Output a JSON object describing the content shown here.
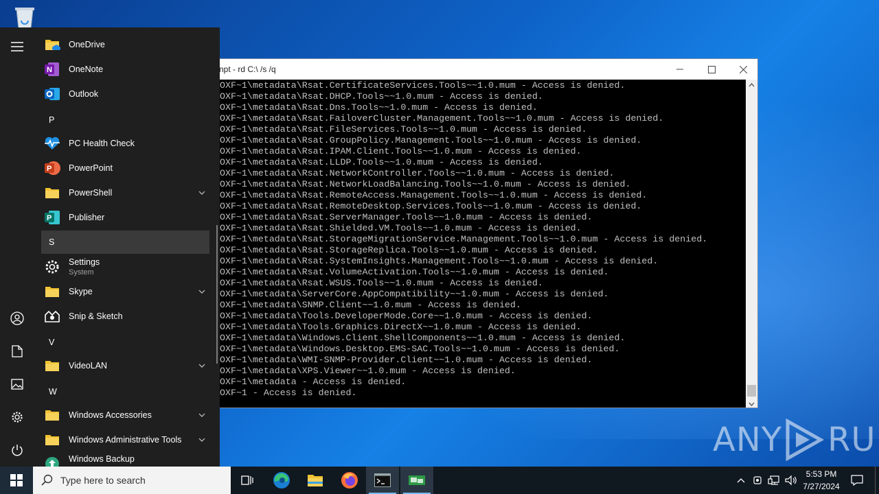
{
  "console": {
    "title": "npt - rd  C:\\ /s /q",
    "lines": [
      "OXF~1\\metadata\\Rsat.CertificateServices.Tools~~1.0.mum - Access is denied.",
      "OXF~1\\metadata\\Rsat.DHCP.Tools~~1.0.mum - Access is denied.",
      "OXF~1\\metadata\\Rsat.Dns.Tools~~1.0.mum - Access is denied.",
      "OXF~1\\metadata\\Rsat.FailoverCluster.Management.Tools~~1.0.mum - Access is denied.",
      "OXF~1\\metadata\\Rsat.FileServices.Tools~~1.0.mum - Access is denied.",
      "OXF~1\\metadata\\Rsat.GroupPolicy.Management.Tools~~1.0.mum - Access is denied.",
      "OXF~1\\metadata\\Rsat.IPAM.Client.Tools~~1.0.mum - Access is denied.",
      "OXF~1\\metadata\\Rsat.LLDP.Tools~~1.0.mum - Access is denied.",
      "OXF~1\\metadata\\Rsat.NetworkController.Tools~~1.0.mum - Access is denied.",
      "OXF~1\\metadata\\Rsat.NetworkLoadBalancing.Tools~~1.0.mum - Access is denied.",
      "OXF~1\\metadata\\Rsat.RemoteAccess.Management.Tools~~1.0.mum - Access is denied.",
      "OXF~1\\metadata\\Rsat.RemoteDesktop.Services.Tools~~1.0.mum - Access is denied.",
      "OXF~1\\metadata\\Rsat.ServerManager.Tools~~1.0.mum - Access is denied.",
      "OXF~1\\metadata\\Rsat.Shielded.VM.Tools~~1.0.mum - Access is denied.",
      "OXF~1\\metadata\\Rsat.StorageMigrationService.Management.Tools~~1.0.mum - Access is denied.",
      "OXF~1\\metadata\\Rsat.StorageReplica.Tools~~1.0.mum - Access is denied.",
      "OXF~1\\metadata\\Rsat.SystemInsights.Management.Tools~~1.0.mum - Access is denied.",
      "OXF~1\\metadata\\Rsat.VolumeActivation.Tools~~1.0.mum - Access is denied.",
      "OXF~1\\metadata\\Rsat.WSUS.Tools~~1.0.mum - Access is denied.",
      "OXF~1\\metadata\\ServerCore.AppCompatibility~~1.0.mum - Access is denied.",
      "OXF~1\\metadata\\SNMP.Client~~1.0.mum - Access is denied.",
      "OXF~1\\metadata\\Tools.DeveloperMode.Core~~1.0.mum - Access is denied.",
      "OXF~1\\metadata\\Tools.Graphics.DirectX~~1.0.mum - Access is denied.",
      "OXF~1\\metadata\\Windows.Client.ShellComponents~~1.0.mum - Access is denied.",
      "OXF~1\\metadata\\Windows.Desktop.EMS-SAC.Tools~~1.0.mum - Access is denied.",
      "OXF~1\\metadata\\WMI-SNMP-Provider.Client~~1.0.mum - Access is denied.",
      "OXF~1\\metadata\\XPS.Viewer~~1.0.mum - Access is denied.",
      "OXF~1\\metadata - Access is denied.",
      "OXF~1 - Access is denied."
    ]
  },
  "start_menu": {
    "apps": {
      "onedrive": "OneDrive",
      "onenote": "OneNote",
      "outlook": "Outlook",
      "letter_p": "P",
      "pc_health": "PC Health Check",
      "powerpoint": "PowerPoint",
      "powershell": "PowerShell",
      "publisher": "Publisher",
      "letter_s": "S",
      "settings": "Settings",
      "settings_sub": "System",
      "skype": "Skype",
      "snip": "Snip & Sketch",
      "letter_v": "V",
      "videolan": "VideoLAN",
      "letter_w": "W",
      "win_accessories": "Windows Accessories",
      "win_admin_tools": "Windows Administrative Tools",
      "win_backup": "Windows Backup"
    }
  },
  "taskbar": {
    "search_placeholder": "Type here to search",
    "time": "5:53 PM",
    "date": "7/27/2024"
  },
  "watermark": {
    "left": "ANY",
    "right": "RUN"
  },
  "icons": [
    "recycle-bin-icon",
    "hamburger-icon",
    "user-icon",
    "document-icon",
    "pictures-icon",
    "gear-icon",
    "power-icon",
    "windows-logo-icon",
    "search-icon",
    "task-view-icon",
    "edge-icon",
    "file-explorer-icon",
    "firefox-icon",
    "cmd-icon",
    "network-app-icon",
    "chevron-up-icon",
    "network-icon",
    "speaker-icon",
    "notification-icon"
  ],
  "colors": {
    "start_bg": "#1f1f1f",
    "taskbar_bg": "#101820",
    "console_text": "#c0c0c0",
    "accent": "#76b9ed"
  }
}
